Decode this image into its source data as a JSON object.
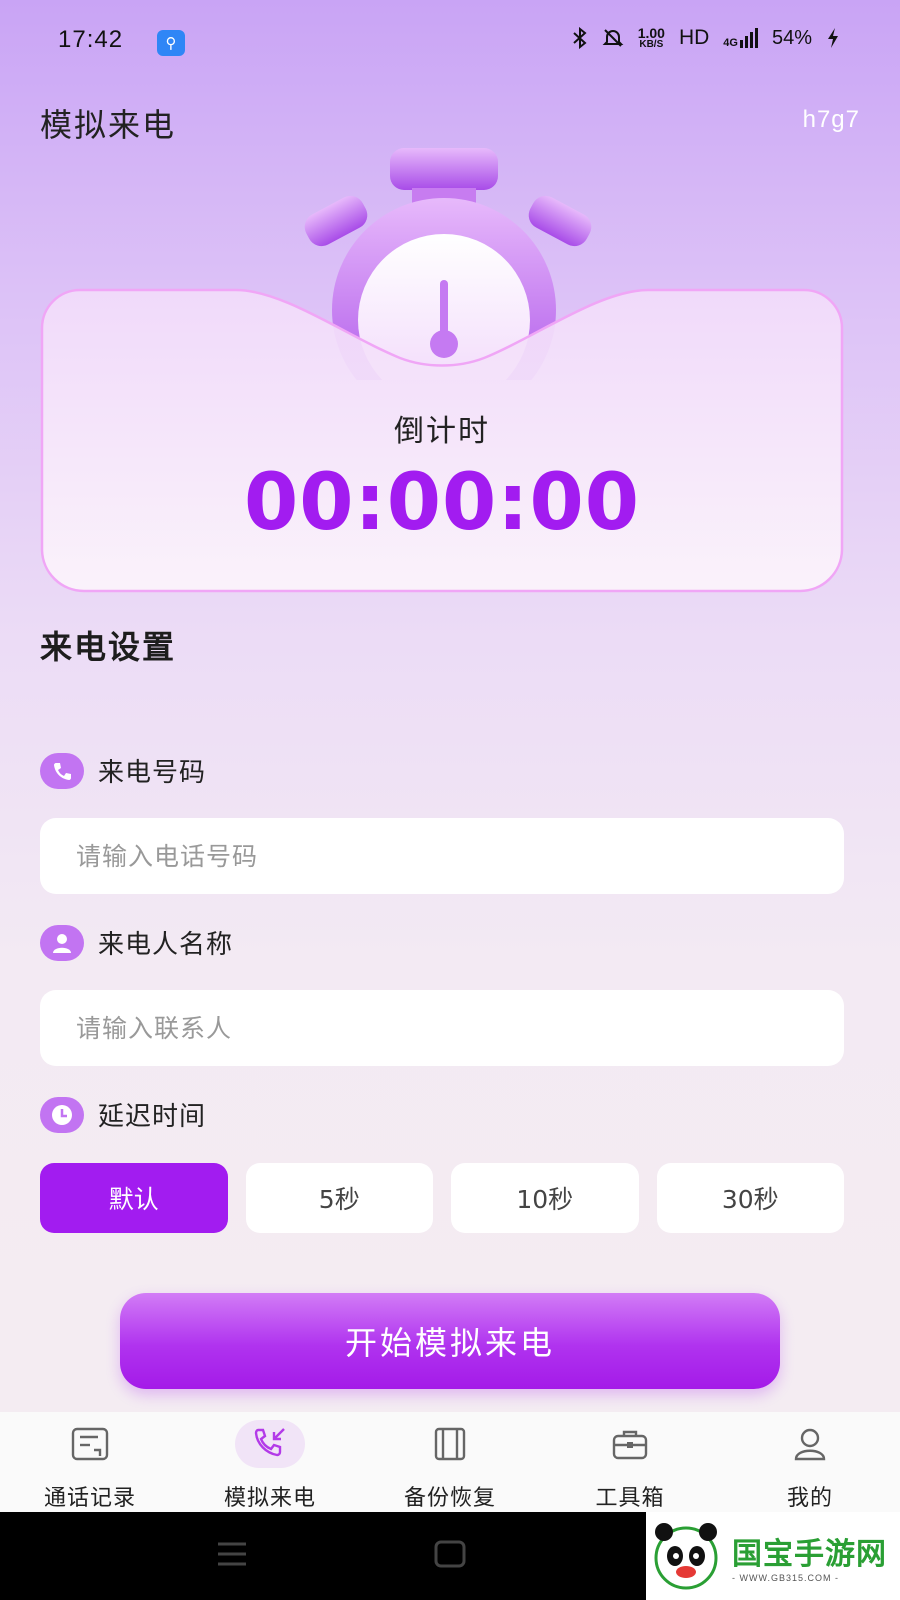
{
  "status_bar": {
    "time": "17:42",
    "usb_icon": "usb-icon",
    "speed_value": "1.00",
    "speed_unit": "KB/S",
    "hd": "HD",
    "network": "4G",
    "battery": "54%"
  },
  "header": {
    "title": "模拟来电",
    "user_code": "h7g7"
  },
  "countdown": {
    "label": "倒计时",
    "value": "00:00:00"
  },
  "settings": {
    "section_title": "来电设置",
    "phone": {
      "label": "来电号码",
      "placeholder": "请输入电话号码",
      "value": ""
    },
    "caller": {
      "label": "来电人名称",
      "placeholder": "请输入联系人",
      "value": ""
    },
    "delay": {
      "label": "延迟时间",
      "options": [
        "默认",
        "5秒",
        "10秒",
        "30秒"
      ],
      "selected": "默认"
    }
  },
  "start_button": "开始模拟来电",
  "bottom_nav": {
    "items": [
      {
        "label": "通话记录",
        "icon": "call-log-icon"
      },
      {
        "label": "模拟来电",
        "icon": "incoming-call-icon"
      },
      {
        "label": "备份恢复",
        "icon": "backup-icon"
      },
      {
        "label": "工具箱",
        "icon": "toolbox-icon"
      },
      {
        "label": "我的",
        "icon": "profile-icon"
      }
    ],
    "active": "模拟来电"
  },
  "watermark": {
    "text": "国宝手游网",
    "sub": "- WWW.GB315.COM -"
  },
  "colors": {
    "accent": "#a21cf0",
    "icon_bg": "#c274f2",
    "gradient_top": "#c9a4f5"
  }
}
